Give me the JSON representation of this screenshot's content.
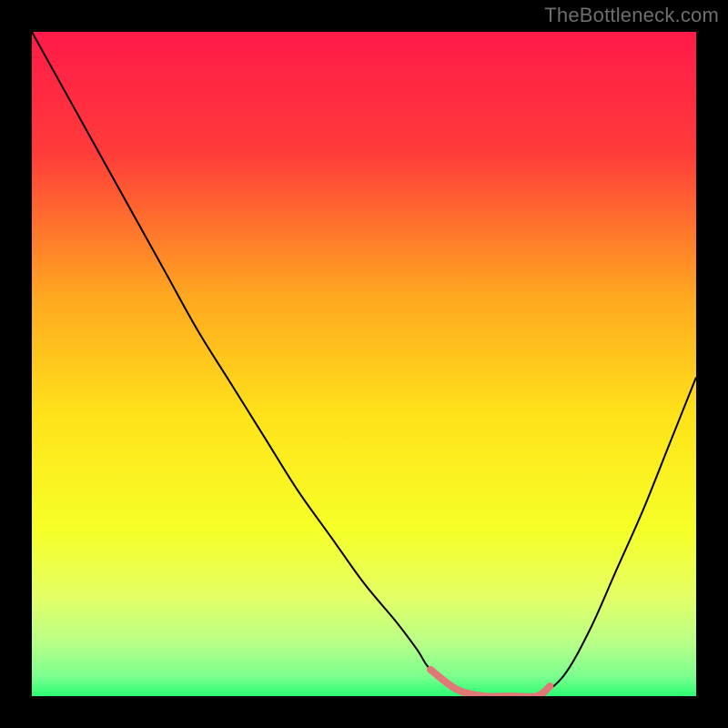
{
  "watermark": "TheBottleneck.com",
  "chart_data": {
    "type": "line",
    "title": "",
    "xlabel": "",
    "ylabel": "",
    "xlim": [
      0,
      100
    ],
    "ylim": [
      0,
      100
    ],
    "grid": false,
    "legend": false,
    "background": {
      "type": "vertical-gradient",
      "description": "red at top through orange, yellow, to green at bottom",
      "stops": [
        {
          "offset": 0.0,
          "color": "#ff1a49"
        },
        {
          "offset": 0.18,
          "color": "#ff3b3a"
        },
        {
          "offset": 0.4,
          "color": "#ffa820"
        },
        {
          "offset": 0.58,
          "color": "#ffe31a"
        },
        {
          "offset": 0.75,
          "color": "#f6ff28"
        },
        {
          "offset": 0.85,
          "color": "#e4ff66"
        },
        {
          "offset": 0.92,
          "color": "#b8ff88"
        },
        {
          "offset": 0.97,
          "color": "#7bff8e"
        },
        {
          "offset": 1.0,
          "color": "#2bfc73"
        }
      ]
    },
    "series": [
      {
        "name": "bottleneck-curve",
        "color": "#000000",
        "stroke_width": 2,
        "note": "values are depth (0 = top of coloured area, 100 = bottom)",
        "x": [
          0,
          5,
          10,
          15,
          20,
          25,
          30,
          35,
          40,
          45,
          50,
          55,
          58,
          60,
          64,
          68,
          72,
          76,
          80,
          84,
          88,
          92,
          96,
          100
        ],
        "y": [
          0,
          9,
          18,
          27,
          36,
          45,
          53,
          61,
          69,
          76,
          83,
          89,
          93,
          96,
          99,
          100,
          100,
          100,
          97,
          90,
          81,
          72,
          62,
          52
        ]
      },
      {
        "name": "flat-valley-segment",
        "color": "#e17878",
        "stroke_width": 8,
        "linecap": "round",
        "x": [
          60,
          64,
          68,
          72,
          76,
          78
        ],
        "y": [
          96,
          99,
          100,
          100,
          100,
          98.5
        ]
      }
    ],
    "annotations": []
  },
  "colors": {
    "frame": "#000000",
    "watermark": "#6e6e6e"
  }
}
